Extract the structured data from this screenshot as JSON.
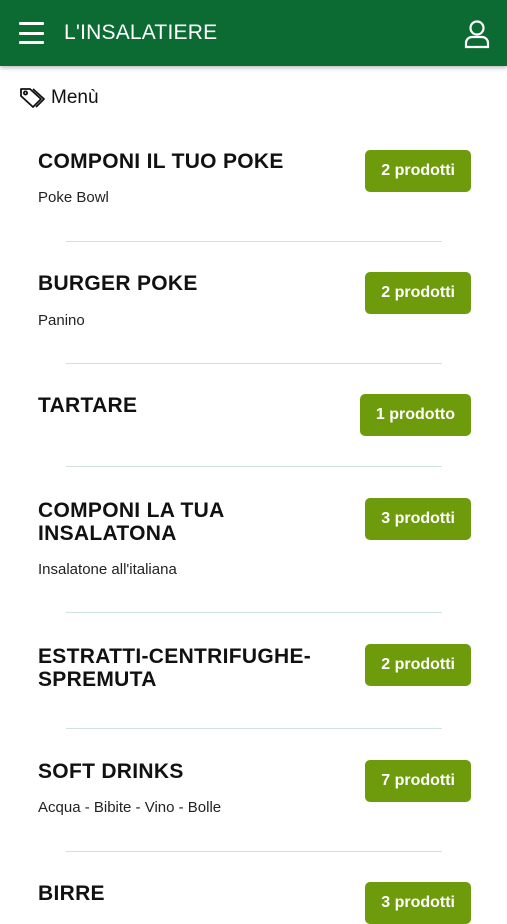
{
  "header": {
    "title": "L'INSALATIERE",
    "menu_icon": "hamburger-menu-icon",
    "account_icon": "user-icon",
    "bar_color": "#0b6b33"
  },
  "breadcrumb": {
    "icon": "tag-icon",
    "label": "Menù"
  },
  "accent_color": "#6e9b0c",
  "categories": [
    {
      "title": "COMPONI IL TUO POKE",
      "subtitle": "Poke Bowl",
      "badge": "2 prodotti"
    },
    {
      "title": "BURGER POKE",
      "subtitle": "Panino",
      "badge": "2 prodotti"
    },
    {
      "title": "TARTARE",
      "subtitle": "",
      "badge": "1 prodotto"
    },
    {
      "title": "COMPONI LA TUA INSALATONA",
      "subtitle": "Insalatone all'italiana",
      "badge": "3 prodotti"
    },
    {
      "title": "ESTRATTI-CENTRIFUGHE-SPREMUTA",
      "subtitle": "",
      "badge": "2 prodotti"
    },
    {
      "title": "SOFT DRINKS",
      "subtitle": "Acqua - Bibite - Vino - Bolle",
      "badge": "7 prodotti"
    },
    {
      "title": "BIRRE",
      "subtitle": "",
      "badge": "3 prodotti"
    }
  ]
}
